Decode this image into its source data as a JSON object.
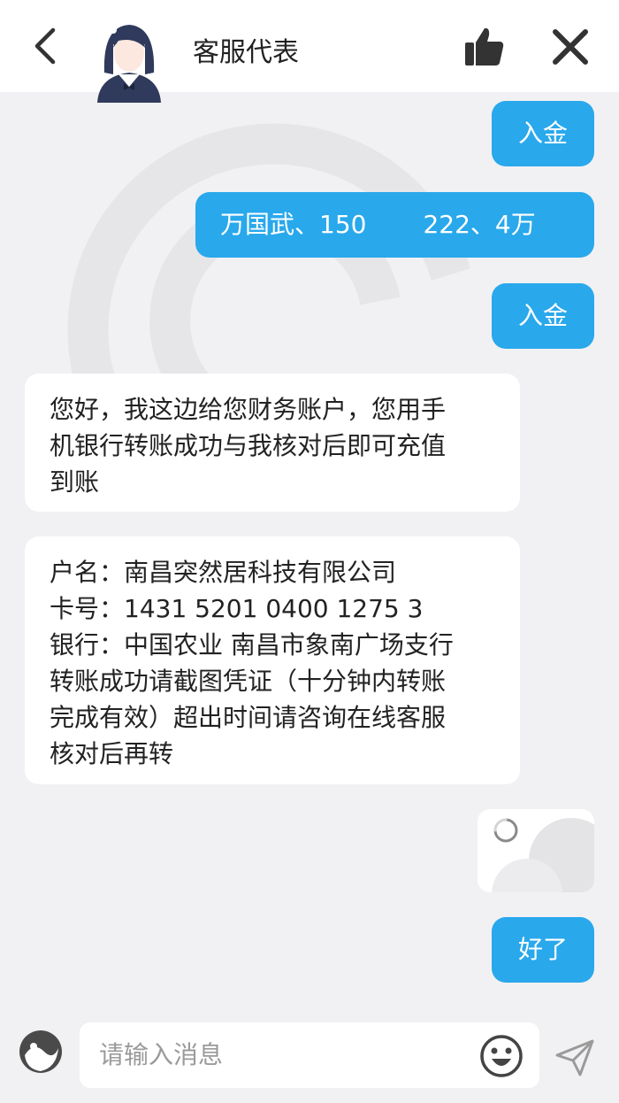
{
  "header": {
    "title": "客服代表"
  },
  "messages": [
    {
      "side": "out",
      "text": "入金"
    },
    {
      "side": "out",
      "parts": [
        "万国武、150",
        "222、4万"
      ]
    },
    {
      "side": "out",
      "text": "入金"
    },
    {
      "side": "in",
      "lines": [
        "您好，我这边给您财务账户，您用手",
        "机银行转账成功与我核对后即可充值",
        "到账"
      ]
    },
    {
      "side": "in",
      "lines": [
        "户名：南昌突然居科技有限公司",
        "卡号：1431 5201 0400 1275 3",
        "银行：中国农业 南昌市象南广场支行",
        "转账成功请截图凭证（十分钟内转账",
        "完成有效）超出时间请咨询在线客服",
        "核对后再转"
      ]
    },
    {
      "side": "out",
      "type": "image-loading"
    },
    {
      "side": "out",
      "text": "好了"
    }
  ],
  "input": {
    "placeholder": "请输入消息"
  },
  "colors": {
    "accent": "#29a8ec",
    "background": "#f1f1f3",
    "bubble_in": "#ffffff"
  },
  "icons": {
    "back": "chevron-left-icon",
    "like": "thumbs-up-icon",
    "close": "close-icon",
    "emoji_left": "sticker-icon",
    "emoji_right": "smiley-icon",
    "send": "send-icon"
  }
}
